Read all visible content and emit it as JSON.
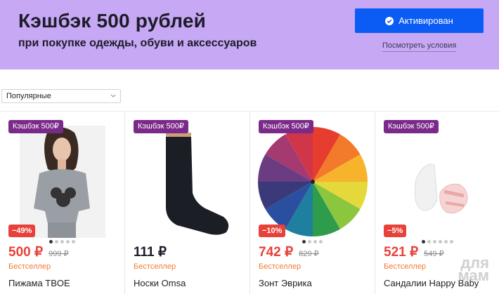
{
  "banner": {
    "title": "Кэшбэк 500 рублей",
    "subtitle": "при покупке одежды, обуви и аксессуаров",
    "activate_label": "Активирован",
    "terms_link": "Посмотреть условия",
    "bg_color": "#c7a8f4",
    "button_color": "#0a5cf5"
  },
  "sort": {
    "selected": "Популярные"
  },
  "products": [
    {
      "badge": "Кэшбэк 500₽",
      "discount": "−49%",
      "price": "500 ₽",
      "old_price": "999 ₽",
      "tag": "Бестселлер",
      "name": "Пижама TBOE",
      "dots_active": 0
    },
    {
      "badge": "Кэшбэк 500₽",
      "discount": "",
      "price": "111 ₽",
      "old_price": "",
      "tag": "Бестселлер",
      "name": "Носки Omsa",
      "dots_active": -1
    },
    {
      "badge": "Кэшбэк 500₽",
      "discount": "−10%",
      "price": "742 ₽",
      "old_price": "829 ₽",
      "tag": "Бестселлер",
      "name": "Зонт Эврика",
      "dots_active": 0
    },
    {
      "badge": "Кэшбэк 500₽",
      "discount": "−5%",
      "price": "521 ₽",
      "old_price": "549 ₽",
      "tag": "Бестселлер",
      "name": "Сандалии Happy Baby",
      "dots_active": 0
    }
  ],
  "watermark": {
    "line1": "для",
    "line2": "мам"
  },
  "colors": {
    "badge": "#7b2a8a",
    "discount": "#e8413a",
    "price_red": "#e8413a",
    "price_dark": "#1c1c2a",
    "tag": "#f47a33"
  }
}
